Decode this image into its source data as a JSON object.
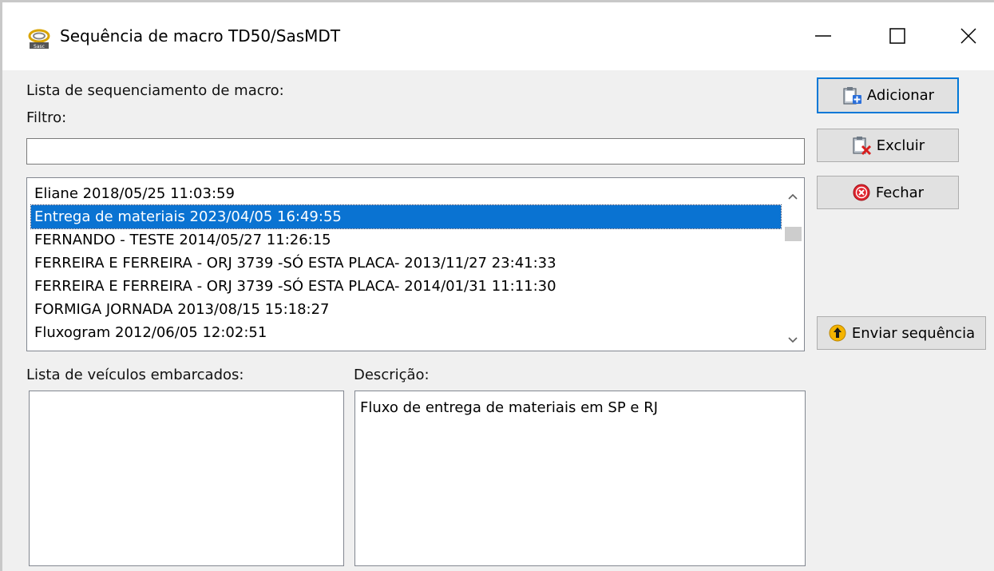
{
  "window": {
    "title": "Sequência de macro TD50/SasMDT",
    "app_icon": "sasmdt-logo-icon",
    "controls": {
      "minimize": "minimize-icon",
      "maximize": "maximize-icon",
      "close": "close-icon"
    }
  },
  "labels": {
    "sequence_list": "Lista de sequenciamento de macro:",
    "filter": "Filtro:",
    "vehicles": "Lista de veículos embarcados:",
    "description": "Descrição:"
  },
  "filter": {
    "value": "",
    "placeholder": ""
  },
  "sequence_list": {
    "items": [
      "Eliane 2018/05/25 11:03:59",
      "Entrega de materiais 2023/04/05 16:49:55",
      "FERNANDO - TESTE 2014/05/27 11:26:15",
      "FERREIRA E FERREIRA - ORJ 3739 -SÓ ESTA PLACA- 2013/11/27 23:41:33",
      "FERREIRA E FERREIRA - ORJ 3739 -SÓ ESTA PLACA- 2014/01/31 11:11:30",
      "FORMIGA JORNADA 2013/08/15 15:18:27",
      "Fluxogram 2012/06/05 12:02:51"
    ],
    "selected_index": 1
  },
  "description": {
    "text": "Fluxo de entrega de materiais em SP e RJ"
  },
  "buttons": {
    "add": {
      "label": "Adicionar",
      "icon": "clipboard-add-icon"
    },
    "delete": {
      "label": "Excluir",
      "icon": "clipboard-delete-icon"
    },
    "close": {
      "label": "Fechar",
      "icon": "close-circle-icon"
    },
    "send": {
      "label": "Enviar sequência",
      "icon": "arrow-up-circle-icon"
    }
  },
  "colors": {
    "selection": "#0a73d2",
    "button_face": "#e1e1e1",
    "focus_border": "#0078d7",
    "close_red": "#e0242e",
    "send_yellow": "#f4b400"
  }
}
